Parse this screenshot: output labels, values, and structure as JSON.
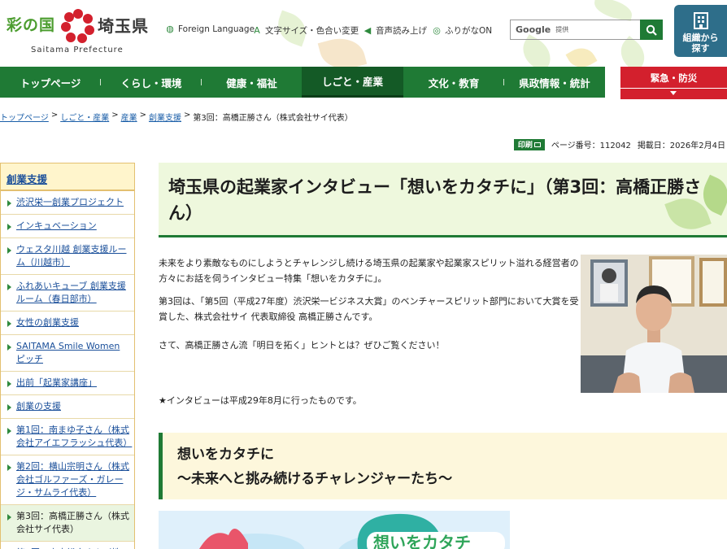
{
  "header": {
    "logo": {
      "left": "彩の国",
      "right": "埼玉県",
      "en": "Saitama Prefecture"
    },
    "utility": [
      {
        "label": "Foreign Language",
        "icon": "globe-icon"
      },
      {
        "label": "文字サイズ・色合い変更",
        "icon": "text-size-icon"
      },
      {
        "label": "音声読み上げ",
        "icon": "speaker-icon"
      },
      {
        "label": "ふりがなON",
        "icon": "furigana-icon"
      }
    ],
    "search": {
      "brand": "Google",
      "placeholder": "提供"
    },
    "org_button": {
      "line1": "組織から",
      "line2": "探す"
    }
  },
  "nav": {
    "items": [
      "トップページ",
      "くらし・環境",
      "健康・福祉",
      "しごと・産業",
      "文化・教育",
      "県政情報・統計"
    ],
    "active": "しごと・産業",
    "emergency": "緊急・防災"
  },
  "breadcrumb": {
    "links": [
      "トップページ",
      "しごと・産業",
      "産業",
      "創業支援"
    ],
    "current": "第3回：高橋正勝さん（株式会社サイ代表）",
    "separator": ">"
  },
  "page_info": {
    "print_label": "印刷",
    "page_number": "ページ番号：112042",
    "published": "掲載日：2026年2月4日"
  },
  "sidebar": {
    "title": "創業支援",
    "items": [
      "渋沢栄一創業プロジェクト",
      "インキュベーション",
      "ウェスタ川越 創業支援ルーム（川越市）",
      "ふれあいキューブ 創業支援ルーム（春日部市）",
      "女性の創業支援",
      "SAITAMA Smile Women ピッチ",
      "出前「起業家講座」",
      "創業の支援",
      "第1回：南まゆ子さん（株式会社アイエフラッシュ代表）",
      "第2回：横山宗明さん（株式会社ゴルファーズ・ガレージ・サムライ代表）",
      "第3回：高橋正勝さん（株式会社サイ代表）",
      "第4回：高木裕之さん（株"
    ],
    "current_index": 10
  },
  "main": {
    "title": "埼玉県の起業家インタビュー「想いをカタチに」（第3回：高橋正勝さん）",
    "paragraphs": [
      "未来をより素敵なものにしようとチャレンジし続ける埼玉県の起業家や起業家スピリット溢れる経営者の方々にお話を伺うインタビュー特集「想いをカタチに」。",
      "第3回は、「第5回（平成27年度）渋沢栄一ビジネス大賞」のベンチャースピリット部門において大賞を受賞した、株式会社サイ 代表取締役 高橋正勝さんです。",
      "さて、高橋正勝さん流「明日を拓く」ヒントとは？ぜひご覧ください！"
    ],
    "note": "★インタビューは平成29年8月に行ったものです。",
    "sub_heading": {
      "line1": "想いをカタチに",
      "line2": "〜未来へと挑み続けるチャレンジャーたち〜"
    },
    "banner_text": "想いをカタチ"
  },
  "colors": {
    "green": "#1f7a35",
    "dark_green": "#145a26",
    "red": "#d3202d",
    "org_blue": "#2e6e8a",
    "link": "#1a4f9a"
  }
}
